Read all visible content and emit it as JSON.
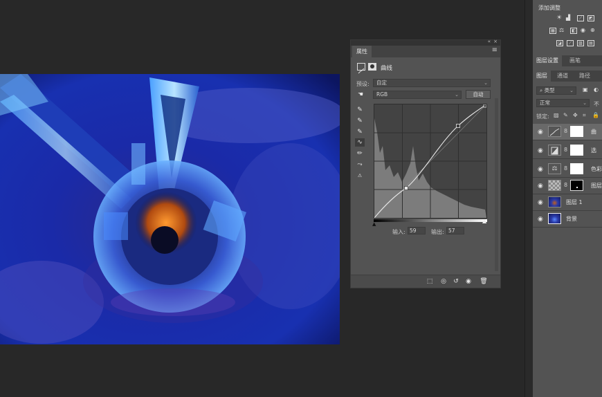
{
  "properties_panel": {
    "tab": "属性",
    "header_title": "曲线",
    "preset_label": "预设:",
    "preset_value": "自定",
    "channel_value": "RGB",
    "auto_button": "自动",
    "input_label": "输入:",
    "input_value": "59",
    "output_label": "输出:",
    "output_value": "57"
  },
  "adjustments_panel": {
    "title": "添加调整"
  },
  "top_tabs": [
    "图层设置",
    "画笔"
  ],
  "layer_tabs": [
    "图层",
    "通道",
    "路径"
  ],
  "layers_panel": {
    "filter_value": "类型",
    "blend_mode": "正常",
    "opacity_label": "不",
    "lock_label": "锁定:",
    "layers": [
      {
        "name": "曲",
        "kind": "curves",
        "active": true
      },
      {
        "name": "选",
        "kind": "selective-color",
        "active": false
      },
      {
        "name": "色彩",
        "kind": "color-balance",
        "active": false
      },
      {
        "name": "图层",
        "kind": "mask",
        "active": false
      },
      {
        "name": "图层 1",
        "kind": "image",
        "active": false
      },
      {
        "name": "背景",
        "kind": "image",
        "active": false
      }
    ]
  },
  "colors": {
    "app_bg": "#282828",
    "panel_bg": "#535353",
    "accent": "#ffffff"
  }
}
